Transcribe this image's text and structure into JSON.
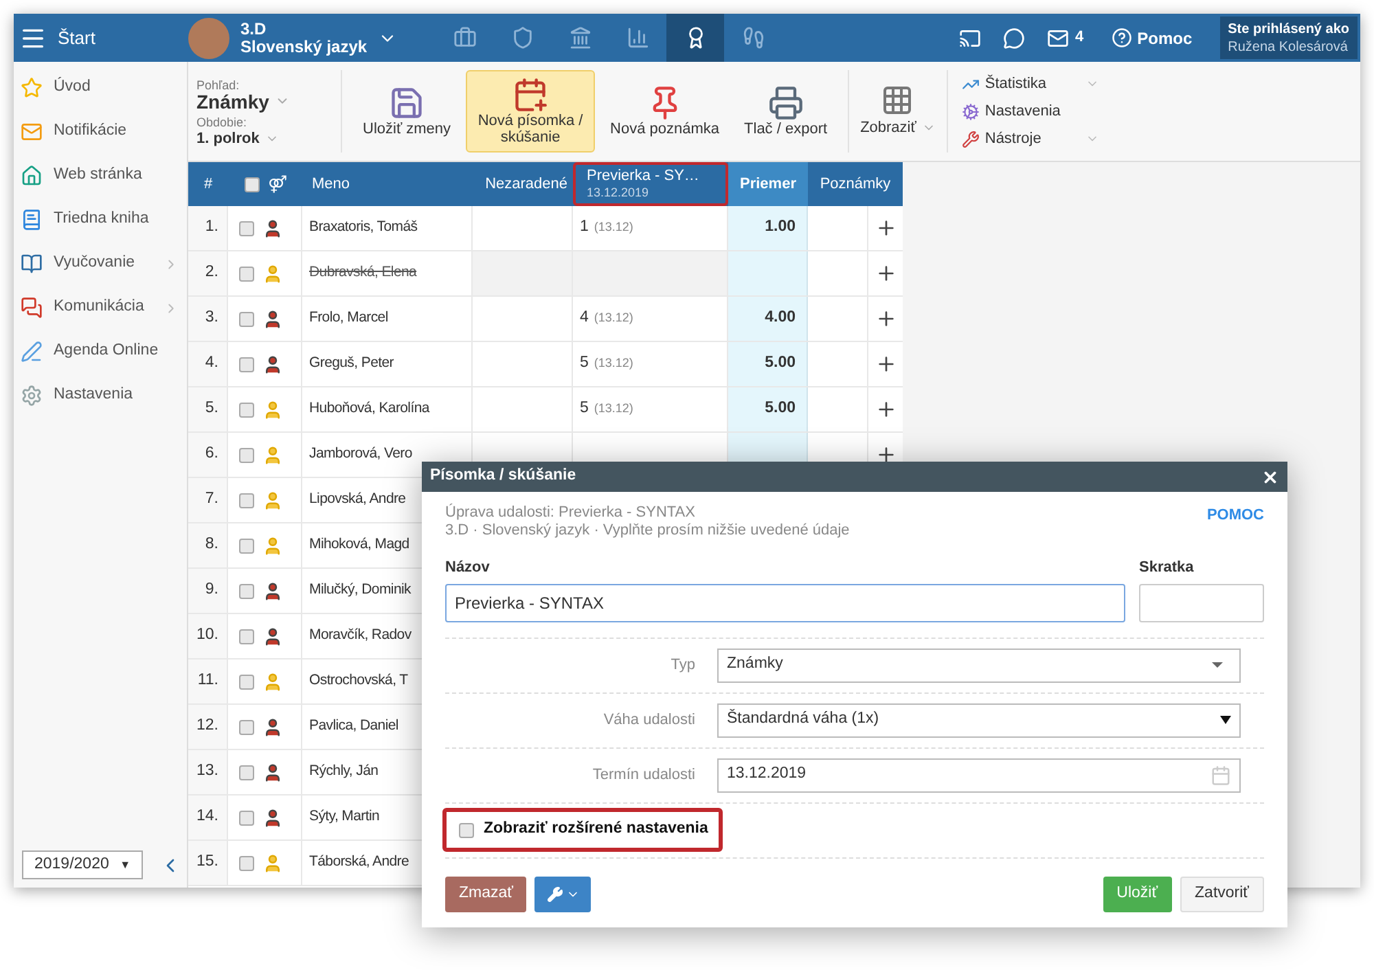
{
  "topbar": {
    "start": "Štart",
    "class_name": "3.D",
    "subject": "Slovenský jazyk",
    "nav_icons": [
      {
        "kind": "briefcase",
        "selected": false
      },
      {
        "kind": "shield",
        "selected": false
      },
      {
        "kind": "bank",
        "selected": false
      },
      {
        "kind": "chart",
        "selected": false
      },
      {
        "kind": "grades",
        "selected": true
      },
      {
        "kind": "walk",
        "selected": false
      }
    ],
    "messages_count": "4",
    "help": "Pomoc",
    "logged_label": "Ste prihlásený ako",
    "user": "Ružena Kolesárová"
  },
  "toolbar": {
    "view_label": "Pohľad:",
    "view": "Známky",
    "period_label": "Obdobie:",
    "period": "1. polrok",
    "buttons": [
      {
        "kind": "save",
        "label": "Uložiť zmeny",
        "selected": false
      },
      {
        "kind": "new-test",
        "label": "Nová písomka / skúšanie",
        "selected": true
      },
      {
        "kind": "note",
        "label": "Nová poznámka",
        "selected": false
      },
      {
        "kind": "print",
        "label": "Tlač / export",
        "selected": false
      }
    ],
    "display": "Zobraziť",
    "menu": [
      {
        "kind": "stats",
        "label": "Štatistika",
        "dropdown": true
      },
      {
        "kind": "settings",
        "label": "Nastavenia",
        "dropdown": false
      },
      {
        "kind": "tools",
        "label": "Nástroje",
        "dropdown": true
      }
    ]
  },
  "sidebar": {
    "items": [
      {
        "kind": "star",
        "label": "Úvod",
        "submenu": false
      },
      {
        "kind": "mail",
        "label": "Notifikácie",
        "submenu": false
      },
      {
        "kind": "home",
        "label": "Web stránka",
        "submenu": false
      },
      {
        "kind": "book",
        "label": "Triedna kniha",
        "submenu": false
      },
      {
        "kind": "open-book",
        "label": "Vyučovanie",
        "submenu": true
      },
      {
        "kind": "chat",
        "label": "Komunikácia",
        "submenu": true
      },
      {
        "kind": "pen",
        "label": "Agenda Online",
        "submenu": false
      },
      {
        "kind": "gear",
        "label": "Nastavenia",
        "submenu": false
      }
    ],
    "year": "2019/2020",
    "year_caret": "▼"
  },
  "table": {
    "columns": {
      "number": "#",
      "all_checked": false,
      "gender_symbol": "⚤",
      "name": "Meno",
      "unassigned": "Nezaradené",
      "test_title": "Previerka - SY…",
      "test_date": "13.12.2019",
      "test_highlighted": true,
      "average": "Priemer",
      "notes": "Poznámky"
    },
    "rows": [
      {
        "number": "1.",
        "name": "Braxatoris, Tomáš",
        "kind": "boy",
        "checked": false,
        "struck": false,
        "grade": "1",
        "grade_date": "(13.12)",
        "average": "1.00"
      },
      {
        "number": "2.",
        "name": "Dubravská, Elena",
        "kind": "girl",
        "checked": false,
        "struck": true
      },
      {
        "number": "3.",
        "name": "Frolo, Marcel",
        "kind": "boy",
        "checked": false,
        "struck": false,
        "grade": "4",
        "grade_date": "(13.12)",
        "average": "4.00"
      },
      {
        "number": "4.",
        "name": "Greguš, Peter",
        "kind": "boy",
        "checked": false,
        "struck": false,
        "grade": "5",
        "grade_date": "(13.12)",
        "average": "5.00"
      },
      {
        "number": "5.",
        "name": "Huboňová, Karolína",
        "kind": "girl",
        "checked": false,
        "struck": false,
        "grade": "5",
        "grade_date": "(13.12)",
        "average": "5.00"
      },
      {
        "number": "6.",
        "name": "Jamborová, Vero",
        "kind": "girl",
        "checked": false,
        "struck": false
      },
      {
        "number": "7.",
        "name": "Lipovská, Andre",
        "kind": "girl",
        "checked": false,
        "struck": false
      },
      {
        "number": "8.",
        "name": "Mihoková, Magd",
        "kind": "girl",
        "checked": false,
        "struck": false
      },
      {
        "number": "9.",
        "name": "Milučký, Dominik",
        "kind": "boy",
        "checked": false,
        "struck": false
      },
      {
        "number": "10.",
        "name": "Moravčík, Radov",
        "kind": "boy",
        "checked": false,
        "struck": false
      },
      {
        "number": "11.",
        "name": "Ostrochovská, T",
        "kind": "girl",
        "checked": false,
        "struck": false
      },
      {
        "number": "12.",
        "name": "Pavlica, Daniel",
        "kind": "boy",
        "checked": false,
        "struck": false
      },
      {
        "number": "13.",
        "name": "Rýchly, Ján",
        "kind": "boy",
        "checked": false,
        "struck": false
      },
      {
        "number": "14.",
        "name": "Sýty, Martin",
        "kind": "boy",
        "checked": false,
        "struck": false
      },
      {
        "number": "15.",
        "name": "Táborská, Andre",
        "kind": "girl",
        "checked": false,
        "struck": false
      }
    ]
  },
  "dialog": {
    "title": "Písomka / skúšanie",
    "subtitle_1": "Úprava udalosti: Previerka - SYNTAX",
    "subtitle_2": "3.D · Slovenský jazyk · Vyplňte prosím nižšie uvedené údaje",
    "help": "POMOC",
    "name_label": "Názov",
    "name_value": "Previerka - SYNTAX",
    "short_label": "Skratka",
    "fields": [
      {
        "kind": "select",
        "label": "Typ",
        "value": "Známky"
      },
      {
        "kind": "native-select",
        "label": "Váha udalosti",
        "value": "Štandardná váha (1x)"
      },
      {
        "kind": "date",
        "label": "Termín udalosti",
        "value": "13.12.2019"
      }
    ],
    "advanced": {
      "label": "Zobraziť rozšírené nastavenia",
      "checked": false,
      "highlighted": true
    },
    "buttons": {
      "delete": "Zmazať",
      "save": "Uložiť",
      "close": "Zatvoriť"
    }
  }
}
